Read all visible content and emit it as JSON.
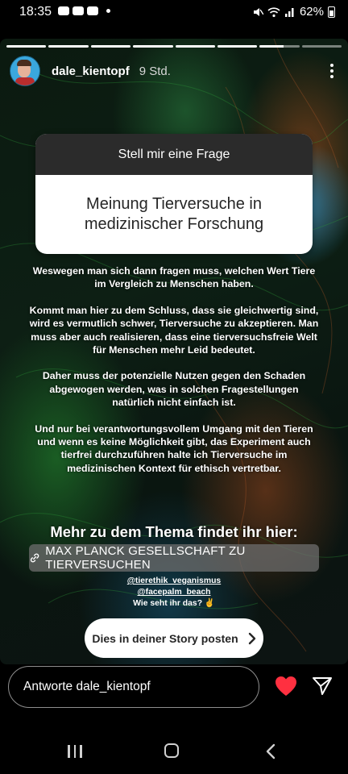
{
  "status_bar": {
    "time": "18:35",
    "battery": "62%"
  },
  "story": {
    "progress": {
      "total_segments": 8,
      "completed": 6,
      "current_fraction": 0.6
    },
    "username": "dale_kientopf",
    "time_ago": "9 Std.",
    "question_sticker": {
      "header": "Stell mir eine Frage",
      "question": "Meinung Tierversuche in medizinischer Forschung"
    },
    "body_paragraphs": [
      "Weswegen man sich dann fragen muss, welchen Wert Tiere im Vergleich zu Menschen haben.",
      "Kommt man hier zu dem Schluss, dass sie gleichwertig sind, wird es vermutlich schwer, Tierversuche zu akzeptieren. Man muss aber auch realisieren, dass eine tierversuchsfreie Welt für Menschen mehr Leid bedeutet.",
      "Daher muss der potenzielle Nutzen gegen den Schaden abgewogen werden, was in solchen Fragestellungen natürlich nicht einfach ist.",
      "Und nur bei verantwortungsvollem Umgang mit den Tieren und wenn es keine Möglichkeit gibt, das Experiment auch tierfrei durchzuführen halte ich Tierversuche im medizinischen Kontext für ethisch vertretbar."
    ],
    "more_title": "Mehr zu dem Thema findet ihr hier:",
    "link_sticker": "MAX PLANCK GESELLSCHAFT ZU TIERVERSUCHEN",
    "mentions": [
      "@tierethik_veganismus",
      "@facepalm_beach"
    ],
    "closing": "Wie seht ihr das? ✌️",
    "share_button": "Dies in deiner Story posten"
  },
  "reply": {
    "placeholder": "Antworte dale_kientopf"
  },
  "colors": {
    "heart": "#ff3040",
    "question_header_bg": "#2b2b2b"
  }
}
